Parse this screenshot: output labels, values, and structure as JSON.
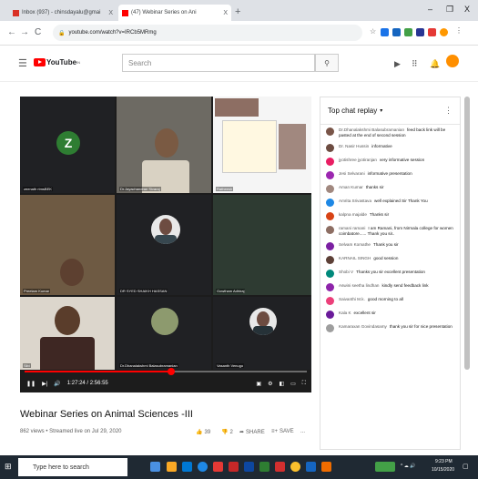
{
  "browser": {
    "tabs": [
      {
        "label": "Inbox (937) - chinsdayalu@gmai",
        "close": "X",
        "fav_color": "#d93025"
      },
      {
        "label": "(47) Webinar Series on Ani",
        "close": "X",
        "fav_color": "#ff0000"
      }
    ],
    "new_tab": "+",
    "minimize": "–",
    "restore": "❐",
    "close": "X",
    "url": "youtube.com/watch?v=IRCb5MRmg",
    "back": "←",
    "forward": "→",
    "reload": "C"
  },
  "youtube": {
    "logo": "YouTube",
    "logo_suffix": "IN",
    "search_placeholder": "Search",
    "search_icon": "search-icon"
  },
  "player": {
    "tiles": [
      {
        "name": "zeenath rimsBEK"
      },
      {
        "name": "Dr.Jayachandran Sivaraj"
      },
      {
        "name": "Ratheesh"
      },
      {
        "name": "Preetam Kumar"
      },
      {
        "name": "DR SYED SHAIKH HASSAN"
      },
      {
        "name": "Gowtham Adhiraj"
      },
      {
        "name": "Sibi"
      },
      {
        "name": "Dr.Dhanalakshmi Balasubramanian"
      },
      {
        "name": "Vasanth Venugo"
      }
    ],
    "time": "1:27:24 / 2:56:55",
    "progress": 0.52,
    "slide_title": "Animal Welfare Act"
  },
  "video": {
    "title": "Webinar Series on Animal Sciences -III",
    "meta": "862 views • Streamed live on Jul 29, 2020",
    "likes": "39",
    "dislikes": "2",
    "share": "SHARE",
    "save": "SAVE",
    "more": "..."
  },
  "chat": {
    "header": "Top chat replay",
    "messages": [
      {
        "author": "Dr.Dhanalakshmi Balasubramanian",
        "text": "feed back link will be pasted at the end of second session",
        "color": "#795548"
      },
      {
        "author": "Dr. Nasir Hussin",
        "text": "informative",
        "color": "#6d4c41"
      },
      {
        "author": "jyotishree jyotiranjan",
        "text": "very informative session",
        "color": "#e91e63"
      },
      {
        "author": "Jesi Selvarani",
        "text": "informative presentation",
        "color": "#9c27b0"
      },
      {
        "author": "Aman Kumar",
        "text": "thanks sir",
        "color": "#a1887f"
      },
      {
        "author": "Amrita Srivastava",
        "text": "well explained Sir Thank You",
        "color": "#1e88e5"
      },
      {
        "author": "kalpna majalde",
        "text": "Thanks sir",
        "color": "#d84315"
      },
      {
        "author": "ramani ramani",
        "text": "I am Ramani, from Nirmala college for women coimbatore...... Thank you sir..",
        "color": "#8d6e63"
      },
      {
        "author": "Selvam Komathe",
        "text": "Thank you sir",
        "color": "#7b1fa2"
      },
      {
        "author": "KARNAIL SINGH",
        "text": "good session",
        "color": "#5d4037"
      },
      {
        "author": "Shobi V",
        "text": "Thanks you sir excellent presentation",
        "color": "#00897b"
      },
      {
        "author": "Aswini seetha lindhan",
        "text": "kindly send feedback link",
        "color": "#8e24aa"
      },
      {
        "author": "Saivanthi M.k.",
        "text": "good morning to all",
        "color": "#ec407a"
      },
      {
        "author": "Kala K",
        "text": "excellent sir",
        "color": "#6a1b9a"
      },
      {
        "author": "Kamaraxan Govindasamy",
        "text": "thank you sir for nice presentation",
        "color": "#9e9e9e"
      }
    ]
  },
  "taskbar": {
    "search": "Type here to search",
    "time": "9:23 PM",
    "date": "10/15/2020"
  }
}
